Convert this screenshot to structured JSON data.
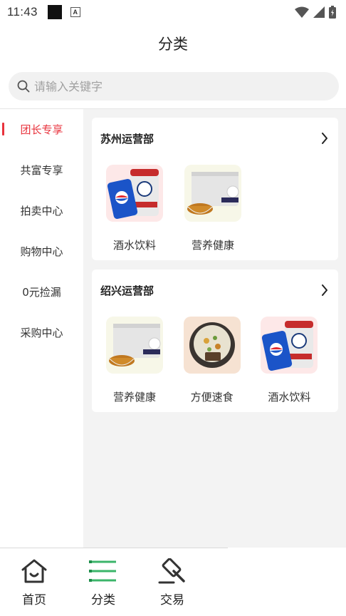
{
  "status_bar": {
    "time": "11:43"
  },
  "header": {
    "title": "分类"
  },
  "search": {
    "placeholder": "请输入关键字"
  },
  "sidebar": {
    "items": [
      {
        "label": "团长专享",
        "active": true
      },
      {
        "label": "共富专享",
        "active": false
      },
      {
        "label": "拍卖中心",
        "active": false
      },
      {
        "label": "购物中心",
        "active": false
      },
      {
        "label": "0元捡漏",
        "active": false
      },
      {
        "label": "采购中心",
        "active": false
      }
    ]
  },
  "sections": [
    {
      "title": "苏州运营部",
      "items": [
        {
          "label": "酒水饮料",
          "icon": "drinks-thumbnail"
        },
        {
          "label": "营养健康",
          "icon": "nutrition-thumbnail"
        }
      ]
    },
    {
      "title": "绍兴运营部",
      "items": [
        {
          "label": "营养健康",
          "icon": "nutrition-thumbnail"
        },
        {
          "label": "方便速食",
          "icon": "instant-food-thumbnail"
        },
        {
          "label": "酒水饮料",
          "icon": "drinks-thumbnail"
        }
      ]
    }
  ],
  "bottom_nav": {
    "tabs": [
      {
        "label": "首页",
        "icon": "home-icon"
      },
      {
        "label": "分类",
        "icon": "list-icon",
        "active": true
      },
      {
        "label": "交易",
        "icon": "gavel-icon"
      }
    ]
  },
  "colors": {
    "accent": "#e8323c",
    "nav_active": "#3bb56a"
  }
}
